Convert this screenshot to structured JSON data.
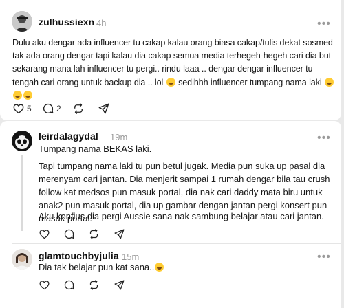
{
  "post": {
    "username": "zulhussiexn",
    "time": "4h",
    "text_lines": [
      "Dulu aku dengar ada influencer tu cakap kalau orang biasa cakap/tulis dekat sosmed",
      "tak ada orang dengar tapi kalau dia cakap semua media terhegeh-hegeh cari dia but",
      "sekarang mana lah influencer tu pergi.. rindu laaa .. dengar dengar influencer tu",
      "tengah cari orang untuk backup dia .. lol",
      "sedihhh influencer tumpang nama laki"
    ],
    "likes": "5",
    "comments": "2"
  },
  "reply1": {
    "username": "leirdalagydal",
    "time": "19m",
    "paragraphs": [
      "Tumpang nama BEKAS laki.",
      "Tapi tumpang nama laki tu pun betul jugak. Media pun suka up pasal dia merenyam cari jantan. Dia menjerit sampai 1 rumah dengar bila tau crush follow kat medsos pun masuk portal, dia nak cari daddy mata biru untuk anak2 pun masuk portal, dia up gambar dengan jantan pergi konsert pun masuk portal.",
      "Aku konfius dia pergi Aussie sana nak sambung belajar atau cari jantan."
    ]
  },
  "reply2": {
    "username": "glamtouchbyjulia",
    "time": "15m",
    "text": "Dia tak belajar pun kat sana.."
  },
  "icons": {
    "heart": "heart-icon",
    "comment": "comment-icon",
    "repost": "repost-icon",
    "share": "share-icon",
    "more": "more-icon"
  },
  "colors": {
    "background": "#e9e9e9",
    "card": "#ffffff",
    "muted": "#9a9a9a"
  }
}
